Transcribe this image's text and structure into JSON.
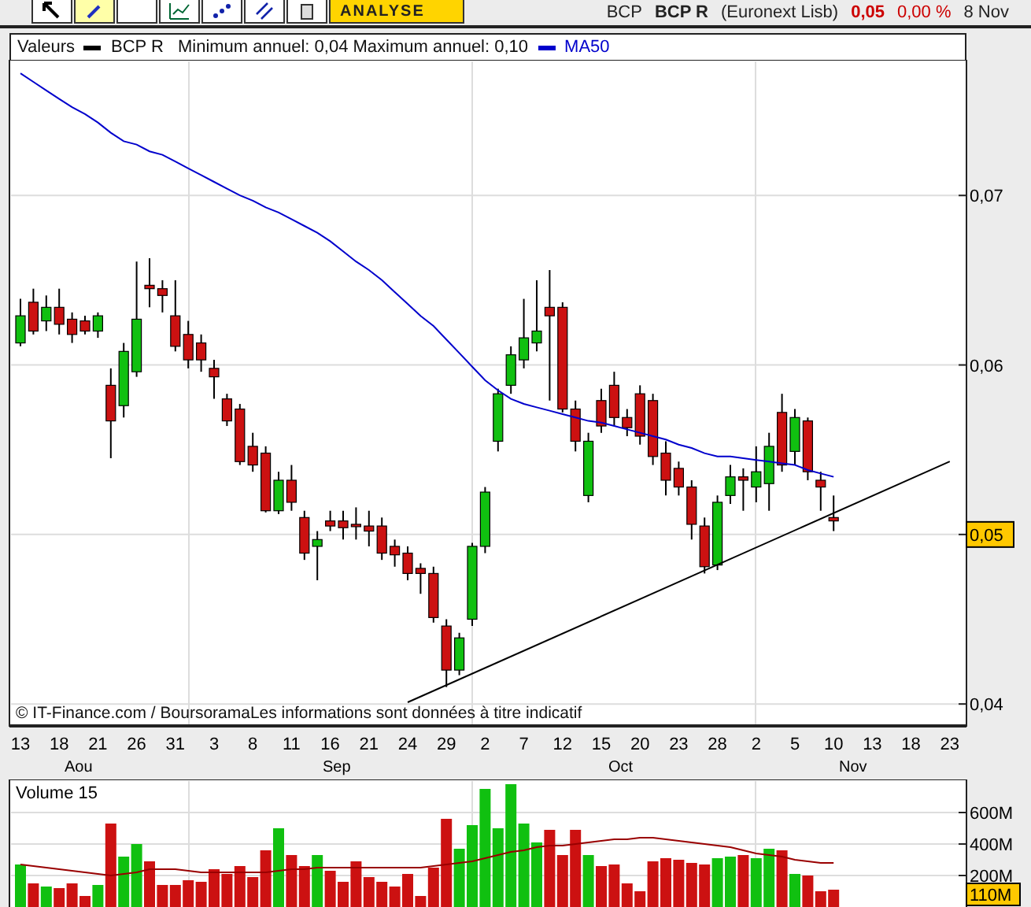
{
  "toolbar": {
    "tools": [
      {
        "kind": "pointer",
        "selected": false
      },
      {
        "kind": "pencil",
        "selected": true
      },
      {
        "kind": "blank",
        "selected": false
      },
      {
        "kind": "chart",
        "selected": false
      },
      {
        "kind": "dots",
        "selected": false
      },
      {
        "kind": "lines",
        "selected": false
      },
      {
        "kind": "trash",
        "selected": false
      }
    ],
    "analyse_button": "ANALYSE"
  },
  "quote": {
    "symbol": "BCP",
    "name": "BCP R",
    "market": "(Euronext Lisb)",
    "price": "0,05",
    "change": "0,00 %",
    "date": "8 Nov"
  },
  "legend": {
    "label": "Valeurs",
    "series": "BCP R",
    "range": "Minimum annuel: 0,04 Maximum annuel: 0,10"
  },
  "price_chart": {
    "credit": "© IT-Finance.com / BoursoramaLes informations sont données à titre indicatif",
    "month_labels": [
      "Aou",
      "Sep",
      "Oct",
      "Nov"
    ],
    "chart_data": {
      "type": "candlestick",
      "grid": true,
      "ylim": [
        0.0388,
        0.078
      ],
      "categories": [
        "13",
        null,
        null,
        "18",
        null,
        null,
        "21",
        null,
        null,
        "26",
        null,
        null,
        "31",
        null,
        null,
        "3",
        null,
        null,
        "8",
        null,
        null,
        "11",
        null,
        null,
        "16",
        null,
        null,
        "21",
        null,
        null,
        "24",
        null,
        null,
        "29",
        null,
        null,
        "2",
        null,
        null,
        "7",
        null,
        null,
        "12",
        null,
        null,
        "15",
        null,
        null,
        "20",
        null,
        null,
        "23",
        null,
        null,
        "28",
        null,
        null,
        "2",
        null,
        null,
        "5",
        null,
        null,
        "10",
        null,
        null,
        "13",
        null,
        null,
        "18",
        null,
        null,
        "23"
      ],
      "yticks": [
        {
          "value": 0.04,
          "label": "0,04"
        },
        {
          "value": 0.05,
          "label": "0,05"
        },
        {
          "value": 0.06,
          "label": "0,06"
        },
        {
          "value": 0.07,
          "label": "0,07"
        }
      ],
      "ohlc": [
        [
          0.0613,
          0.0639,
          0.0611,
          0.0629
        ],
        [
          0.0637,
          0.0645,
          0.0618,
          0.062
        ],
        [
          0.0626,
          0.0641,
          0.062,
          0.0634
        ],
        [
          0.0634,
          0.0645,
          0.0618,
          0.0624
        ],
        [
          0.0627,
          0.0631,
          0.0613,
          0.0618
        ],
        [
          0.0626,
          0.0629,
          0.0618,
          0.062
        ],
        [
          0.062,
          0.0631,
          0.0616,
          0.0629
        ],
        [
          0.0588,
          0.0598,
          0.0545,
          0.0567
        ],
        [
          0.0576,
          0.0613,
          0.0569,
          0.0608
        ],
        [
          0.0596,
          0.0661,
          0.0593,
          0.0627
        ],
        [
          0.0647,
          0.0663,
          0.0634,
          0.0645
        ],
        [
          0.0645,
          0.065,
          0.0631,
          0.0641
        ],
        [
          0.0629,
          0.065,
          0.0608,
          0.0611
        ],
        [
          0.0618,
          0.0626,
          0.0598,
          0.0603
        ],
        [
          0.0613,
          0.0618,
          0.0596,
          0.0603
        ],
        [
          0.0598,
          0.0603,
          0.058,
          0.0593
        ],
        [
          0.058,
          0.0583,
          0.0564,
          0.0567
        ],
        [
          0.0574,
          0.0577,
          0.0541,
          0.0543
        ],
        [
          0.0552,
          0.056,
          0.0537,
          0.0541
        ],
        [
          0.0548,
          0.0552,
          0.0513,
          0.0514
        ],
        [
          0.0514,
          0.0537,
          0.0512,
          0.0532
        ],
        [
          0.0532,
          0.0541,
          0.0514,
          0.0519
        ],
        [
          0.051,
          0.0514,
          0.0485,
          0.0489
        ],
        [
          0.0493,
          0.0502,
          0.0473,
          0.0497
        ],
        [
          0.0508,
          0.0514,
          0.0502,
          0.0505
        ],
        [
          0.0508,
          0.0514,
          0.0497,
          0.0504
        ],
        [
          0.0506,
          0.0516,
          0.0497,
          0.0505
        ],
        [
          0.0505,
          0.0514,
          0.0493,
          0.0502
        ],
        [
          0.0505,
          0.051,
          0.0485,
          0.0489
        ],
        [
          0.0493,
          0.0497,
          0.0481,
          0.0488
        ],
        [
          0.0489,
          0.0493,
          0.0473,
          0.0477
        ],
        [
          0.048,
          0.0483,
          0.0465,
          0.0477
        ],
        [
          0.0477,
          0.0481,
          0.0448,
          0.0451
        ],
        [
          0.0446,
          0.045,
          0.041,
          0.042
        ],
        [
          0.042,
          0.0442,
          0.0417,
          0.0439
        ],
        [
          0.045,
          0.0495,
          0.0446,
          0.0493
        ],
        [
          0.0493,
          0.0528,
          0.0489,
          0.0525
        ],
        [
          0.0555,
          0.0586,
          0.0549,
          0.0583
        ],
        [
          0.0588,
          0.0611,
          0.0583,
          0.0606
        ],
        [
          0.0603,
          0.0639,
          0.0598,
          0.0616
        ],
        [
          0.0613,
          0.065,
          0.0608,
          0.062
        ],
        [
          0.0634,
          0.0656,
          0.0579,
          0.0629
        ],
        [
          0.0634,
          0.0637,
          0.0572,
          0.0574
        ],
        [
          0.0574,
          0.0579,
          0.0549,
          0.0555
        ],
        [
          0.0523,
          0.056,
          0.0519,
          0.0555
        ],
        [
          0.0579,
          0.0586,
          0.056,
          0.0564
        ],
        [
          0.0588,
          0.0596,
          0.0564,
          0.0569
        ],
        [
          0.0569,
          0.0574,
          0.0558,
          0.0563
        ],
        [
          0.0583,
          0.0588,
          0.0553,
          0.0558
        ],
        [
          0.0579,
          0.0583,
          0.0541,
          0.0546
        ],
        [
          0.0548,
          0.0555,
          0.0523,
          0.0532
        ],
        [
          0.0539,
          0.0543,
          0.0523,
          0.0528
        ],
        [
          0.0528,
          0.0532,
          0.0497,
          0.0506
        ],
        [
          0.0505,
          0.051,
          0.0477,
          0.0481
        ],
        [
          0.0482,
          0.0523,
          0.0479,
          0.0519
        ],
        [
          0.0523,
          0.0541,
          0.0518,
          0.0534
        ],
        [
          0.0534,
          0.0539,
          0.0514,
          0.0532
        ],
        [
          0.0528,
          0.0552,
          0.0519,
          0.0537
        ],
        [
          0.053,
          0.056,
          0.0514,
          0.0552
        ],
        [
          0.0572,
          0.0583,
          0.0537,
          0.0541
        ],
        [
          0.0549,
          0.0574,
          0.0541,
          0.0569
        ],
        [
          0.0567,
          0.0569,
          0.0532,
          0.0537
        ],
        [
          0.0532,
          0.0537,
          0.0514,
          0.0528
        ],
        [
          0.051,
          0.0523,
          0.0502,
          0.0508
        ],
        null,
        null,
        null,
        null,
        null,
        null,
        null,
        null,
        null
      ],
      "series": [
        {
          "name": "MA50",
          "type": "line",
          "color": "#0000cc",
          "values": [
            0.0772,
            0.0767,
            0.0762,
            0.0757,
            0.0752,
            0.0748,
            0.0743,
            0.0737,
            0.0732,
            0.073,
            0.0726,
            0.0724,
            0.072,
            0.0716,
            0.0712,
            0.0708,
            0.0704,
            0.07,
            0.0697,
            0.0693,
            0.069,
            0.0686,
            0.0682,
            0.0678,
            0.0673,
            0.0667,
            0.0661,
            0.0656,
            0.065,
            0.0643,
            0.0636,
            0.0629,
            0.0623,
            0.0615,
            0.0607,
            0.0599,
            0.0591,
            0.0585,
            0.058,
            0.0577,
            0.0575,
            0.0573,
            0.0571,
            0.0569,
            0.0567,
            0.0566,
            0.0564,
            0.0562,
            0.056,
            0.0558,
            0.0556,
            0.0553,
            0.0551,
            0.0548,
            0.0546,
            0.0546,
            0.0545,
            0.0544,
            0.0543,
            0.0542,
            0.0541,
            0.0538,
            0.0536,
            0.0534,
            null,
            null,
            null,
            null,
            null,
            null,
            null,
            null,
            null
          ]
        },
        {
          "type": "line",
          "color": "#000000",
          "values": [
            null,
            null,
            null,
            null,
            null,
            null,
            null,
            null,
            null,
            null,
            null,
            null,
            null,
            null,
            null,
            null,
            null,
            null,
            null,
            null,
            null,
            null,
            null,
            null,
            null,
            null,
            null,
            null,
            null,
            null,
            0.0401,
            null,
            null,
            null,
            null,
            null,
            null,
            null,
            null,
            null,
            null,
            null,
            null,
            null,
            null,
            null,
            null,
            null,
            null,
            null,
            null,
            null,
            null,
            null,
            null,
            null,
            null,
            null,
            null,
            null,
            null,
            null,
            null,
            null,
            null,
            null,
            null,
            null,
            null,
            null,
            null,
            null,
            0.0543
          ]
        }
      ]
    }
  },
  "volume_chart": {
    "current_volume": "110M",
    "chart_data": {
      "type": "bar",
      "title": "Volume 15",
      "grid": true,
      "ylim": [
        0,
        780
      ],
      "yticks": [
        {
          "value": 200,
          "label": "200M"
        },
        {
          "value": 400,
          "label": "400M"
        },
        {
          "value": 600,
          "label": "600M"
        }
      ],
      "series": [
        {
          "values": [
            270,
            150,
            130,
            120,
            150,
            70,
            140,
            530,
            320,
            400,
            290,
            140,
            140,
            170,
            160,
            240,
            210,
            260,
            190,
            360,
            500,
            330,
            260,
            330,
            230,
            160,
            290,
            190,
            160,
            130,
            210,
            70,
            250,
            560,
            370,
            520,
            750,
            500,
            780,
            530,
            410,
            490,
            330,
            490,
            330,
            260,
            270,
            150,
            100,
            290,
            310,
            300,
            280,
            270,
            310,
            320,
            330,
            310,
            370,
            360,
            210,
            200,
            100,
            110
          ],
          "colors": [
            "#10c010",
            "#cc1111",
            "#10c010",
            "#cc1111",
            "#cc1111",
            "#cc1111",
            "#10c010",
            "#cc1111",
            "#10c010",
            "#10c010",
            "#cc1111",
            "#cc1111",
            "#cc1111",
            "#cc1111",
            "#cc1111",
            "#cc1111",
            "#cc1111",
            "#cc1111",
            "#cc1111",
            "#cc1111",
            "#10c010",
            "#cc1111",
            "#cc1111",
            "#10c010",
            "#cc1111",
            "#cc1111",
            "#cc1111",
            "#cc1111",
            "#cc1111",
            "#cc1111",
            "#cc1111",
            "#cc1111",
            "#cc1111",
            "#cc1111",
            "#10c010",
            "#10c010",
            "#10c010",
            "#10c010",
            "#10c010",
            "#10c010",
            "#10c010",
            "#cc1111",
            "#cc1111",
            "#cc1111",
            "#10c010",
            "#cc1111",
            "#cc1111",
            "#cc1111",
            "#cc1111",
            "#cc1111",
            "#cc1111",
            "#cc1111",
            "#cc1111",
            "#cc1111",
            "#10c010",
            "#10c010",
            "#cc1111",
            "#10c010",
            "#10c010",
            "#cc1111",
            "#10c010",
            "#cc1111",
            "#cc1111",
            "#cc1111"
          ]
        },
        {
          "type": "line",
          "color": "#990000",
          "values": [
            270,
            260,
            250,
            240,
            230,
            220,
            210,
            200,
            210,
            220,
            240,
            240,
            240,
            230,
            220,
            220,
            220,
            220,
            220,
            220,
            230,
            240,
            240,
            250,
            250,
            250,
            250,
            250,
            250,
            250,
            250,
            250,
            260,
            270,
            280,
            290,
            310,
            330,
            350,
            360,
            380,
            390,
            390,
            400,
            410,
            420,
            430,
            430,
            440,
            440,
            430,
            420,
            410,
            400,
            390,
            380,
            360,
            340,
            330,
            320,
            300,
            290,
            280,
            280
          ]
        }
      ]
    }
  }
}
